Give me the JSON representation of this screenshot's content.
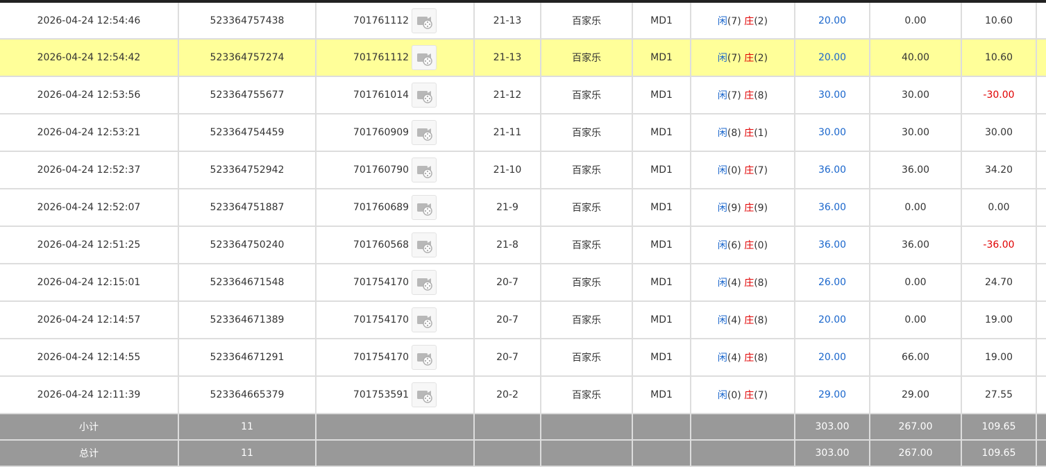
{
  "rows": [
    {
      "time": "2026-04-24 12:54:46",
      "bet_id": "523364757438",
      "round": "701761112",
      "shoe": "21-13",
      "game": "百家乐",
      "table": "MD1",
      "player_label": "闲",
      "player": "(7)",
      "banker_label": "庄",
      "banker": "(2)",
      "bet": "20.00",
      "valid": "0.00",
      "win": "10.60",
      "win_negative": false
    },
    {
      "time": "2026-04-24 12:54:42",
      "bet_id": "523364757274",
      "round": "701761112",
      "shoe": "21-13",
      "game": "百家乐",
      "table": "MD1",
      "player_label": "闲",
      "player": "(7)",
      "banker_label": "庄",
      "banker": "(2)",
      "bet": "20.00",
      "valid": "40.00",
      "win": "10.60",
      "win_negative": false
    },
    {
      "time": "2026-04-24 12:53:56",
      "bet_id": "523364755677",
      "round": "701761014",
      "shoe": "21-12",
      "game": "百家乐",
      "table": "MD1",
      "player_label": "闲",
      "player": "(7)",
      "banker_label": "庄",
      "banker": "(8)",
      "bet": "30.00",
      "valid": "30.00",
      "win": "-30.00",
      "win_negative": true
    },
    {
      "time": "2026-04-24 12:53:21",
      "bet_id": "523364754459",
      "round": "701760909",
      "shoe": "21-11",
      "game": "百家乐",
      "table": "MD1",
      "player_label": "闲",
      "player": "(8)",
      "banker_label": "庄",
      "banker": "(1)",
      "bet": "30.00",
      "valid": "30.00",
      "win": "30.00",
      "win_negative": false
    },
    {
      "time": "2026-04-24 12:52:37",
      "bet_id": "523364752942",
      "round": "701760790",
      "shoe": "21-10",
      "game": "百家乐",
      "table": "MD1",
      "player_label": "闲",
      "player": "(0)",
      "banker_label": "庄",
      "banker": "(7)",
      "bet": "36.00",
      "valid": "36.00",
      "win": "34.20",
      "win_negative": false
    },
    {
      "time": "2026-04-24 12:52:07",
      "bet_id": "523364751887",
      "round": "701760689",
      "shoe": "21-9",
      "game": "百家乐",
      "table": "MD1",
      "player_label": "闲",
      "player": "(9)",
      "banker_label": "庄",
      "banker": "(9)",
      "bet": "36.00",
      "valid": "0.00",
      "win": "0.00",
      "win_negative": false
    },
    {
      "time": "2026-04-24 12:51:25",
      "bet_id": "523364750240",
      "round": "701760568",
      "shoe": "21-8",
      "game": "百家乐",
      "table": "MD1",
      "player_label": "闲",
      "player": "(6)",
      "banker_label": "庄",
      "banker": "(0)",
      "bet": "36.00",
      "valid": "36.00",
      "win": "-36.00",
      "win_negative": true
    },
    {
      "time": "2026-04-24 12:15:01",
      "bet_id": "523364671548",
      "round": "701754170",
      "shoe": "20-7",
      "game": "百家乐",
      "table": "MD1",
      "player_label": "闲",
      "player": "(4)",
      "banker_label": "庄",
      "banker": "(8)",
      "bet": "26.00",
      "valid": "0.00",
      "win": "24.70",
      "win_negative": false
    },
    {
      "time": "2026-04-24 12:14:57",
      "bet_id": "523364671389",
      "round": "701754170",
      "shoe": "20-7",
      "game": "百家乐",
      "table": "MD1",
      "player_label": "闲",
      "player": "(4)",
      "banker_label": "庄",
      "banker": "(8)",
      "bet": "20.00",
      "valid": "0.00",
      "win": "19.00",
      "win_negative": false
    },
    {
      "time": "2026-04-24 12:14:55",
      "bet_id": "523364671291",
      "round": "701754170",
      "shoe": "20-7",
      "game": "百家乐",
      "table": "MD1",
      "player_label": "闲",
      "player": "(4)",
      "banker_label": "庄",
      "banker": "(8)",
      "bet": "20.00",
      "valid": "66.00",
      "win": "19.00",
      "win_negative": false
    },
    {
      "time": "2026-04-24 12:11:39",
      "bet_id": "523364665379",
      "round": "701753591",
      "shoe": "20-2",
      "game": "百家乐",
      "table": "MD1",
      "player_label": "闲",
      "player": "(0)",
      "banker_label": "庄",
      "banker": "(7)",
      "bet": "29.00",
      "valid": "29.00",
      "win": "27.55",
      "win_negative": false
    }
  ],
  "highlighted_row": 1,
  "subtotal": {
    "label": "小计",
    "count": "11",
    "bet": "303.00",
    "valid": "267.00",
    "win": "109.65"
  },
  "total": {
    "label": "总计",
    "count": "11",
    "bet": "303.00",
    "valid": "267.00",
    "win": "109.65"
  },
  "colors": {
    "highlight": "#ffff99",
    "summary_bg": "#999999",
    "bet_blue": "#1a66cc",
    "negative_red": "#e00000"
  },
  "icons": {
    "replay": "film-reel-replay-icon"
  }
}
